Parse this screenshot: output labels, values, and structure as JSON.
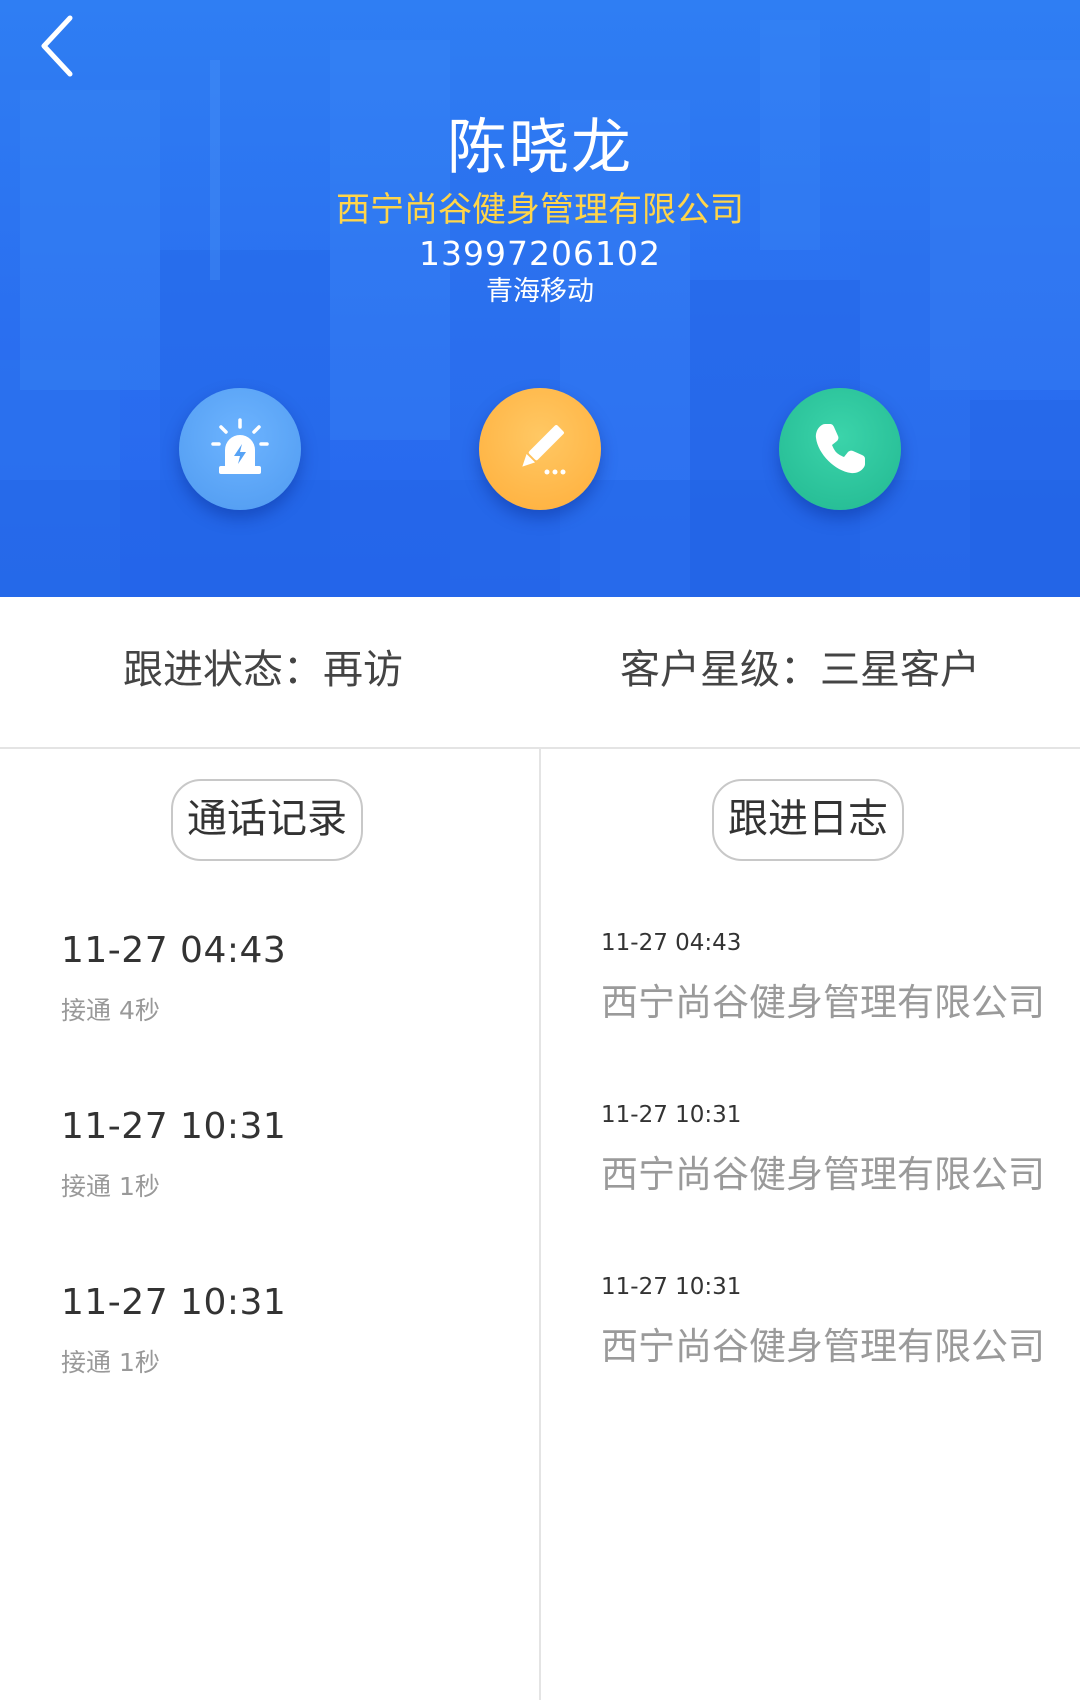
{
  "header": {
    "name": "陈晓龙",
    "company": "西宁尚谷健身管理有限公司",
    "phone": "13997206102",
    "carrier": "青海移动",
    "back_icon": "chevron-left-icon",
    "actions": [
      {
        "icon": "alarm-siren-icon",
        "color": "#57a3f5"
      },
      {
        "icon": "edit-pencil-icon",
        "color": "#ffb845"
      },
      {
        "icon": "phone-call-icon",
        "color": "#2cc39c"
      }
    ]
  },
  "status": {
    "follow_label": "跟进状态：",
    "follow_value": "再访",
    "level_label": "客户星级：",
    "level_value": "三星客户"
  },
  "tabs": {
    "calls": "通话记录",
    "log": "跟进日志"
  },
  "call_records": [
    {
      "time": "11-27 04:43",
      "status": "接通 4秒"
    },
    {
      "time": "11-27 10:31",
      "status": "接通 1秒"
    },
    {
      "time": "11-27 10:31",
      "status": "接通 1秒"
    }
  ],
  "follow_logs": [
    {
      "time": "11-27 04:43",
      "text": "西宁尚谷健身管理有限公司"
    },
    {
      "time": "11-27 10:31",
      "text": "西宁尚谷健身管理有限公司"
    },
    {
      "time": "11-27 10:31",
      "text": "西宁尚谷健身管理有限公司"
    }
  ],
  "colors": {
    "header_blue": "#2a6ff0",
    "company_yellow": "#ffd54a"
  }
}
